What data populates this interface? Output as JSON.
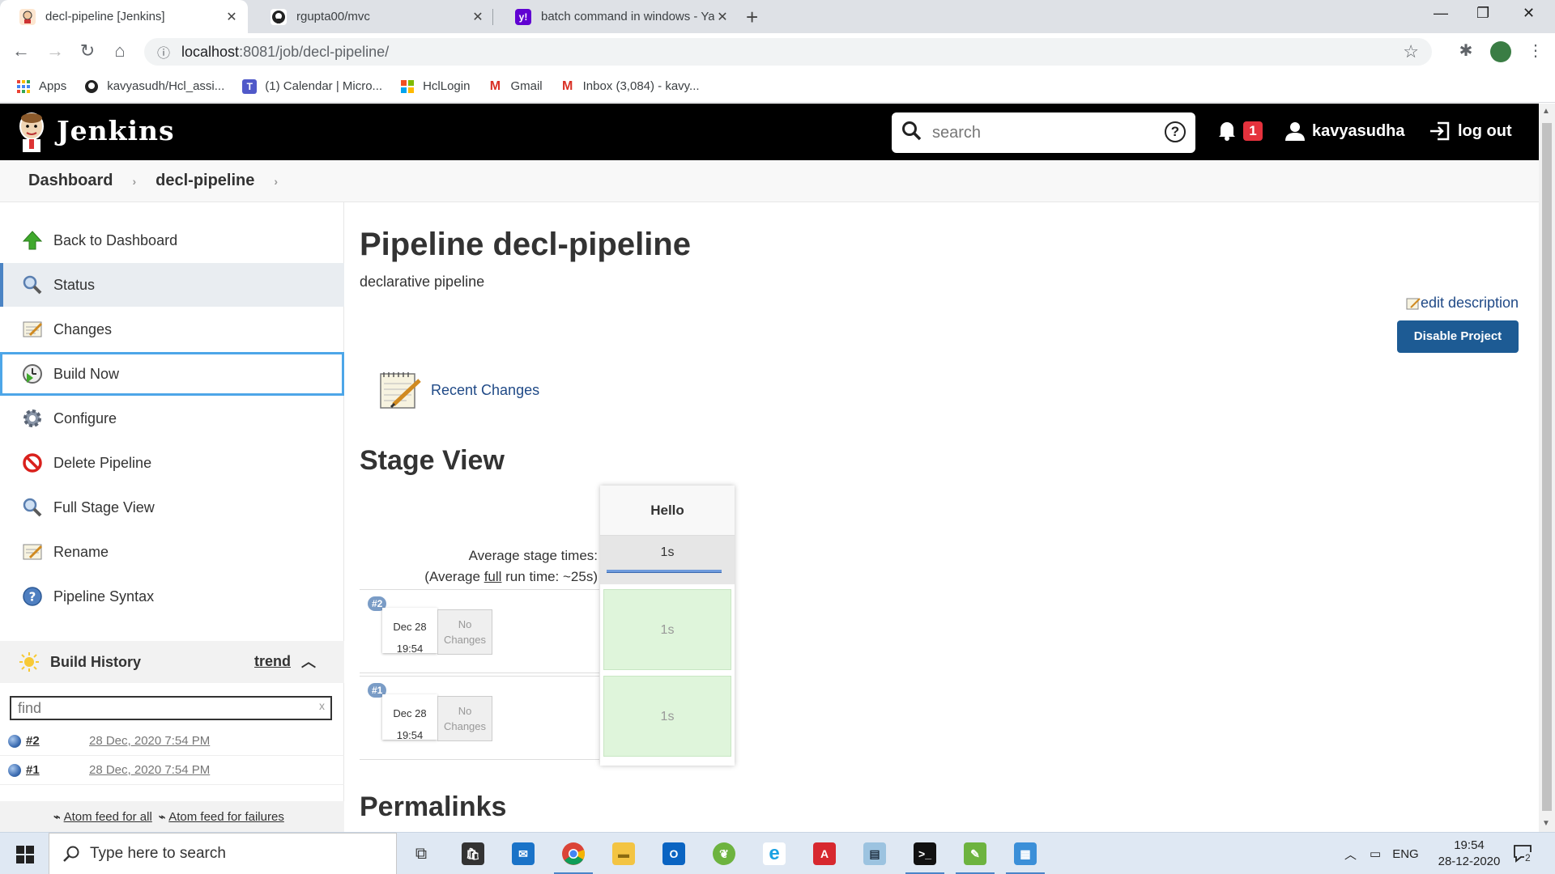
{
  "browser": {
    "tabs": [
      {
        "title": "decl-pipeline [Jenkins]",
        "active": true
      },
      {
        "title": "rgupta00/mvc",
        "active": false
      },
      {
        "title": "batch command in windows - Ya",
        "active": false
      }
    ],
    "url_host": "localhost",
    "url_path": ":8081/job/decl-pipeline/",
    "bookmarks": [
      "Apps",
      "kavyasudh/Hcl_assi...",
      "(1) Calendar | Micro...",
      "HclLogin",
      "Gmail",
      "Inbox (3,084) - kavy..."
    ]
  },
  "header": {
    "brand": "Jenkins",
    "search_placeholder": "search",
    "notification_count": "1",
    "username": "kavyasudha",
    "logout_label": "log out"
  },
  "breadcrumb": [
    "Dashboard",
    "decl-pipeline"
  ],
  "sidebar": {
    "tasks": [
      {
        "label": "Back to Dashboard",
        "icon": "arrow-up-icon"
      },
      {
        "label": "Status",
        "icon": "search-icon"
      },
      {
        "label": "Changes",
        "icon": "notepad-icon"
      },
      {
        "label": "Build Now",
        "icon": "clock-play-icon"
      },
      {
        "label": "Configure",
        "icon": "gear-icon"
      },
      {
        "label": "Delete Pipeline",
        "icon": "no-entry-icon"
      },
      {
        "label": "Full Stage View",
        "icon": "search-icon"
      },
      {
        "label": "Rename",
        "icon": "notepad-icon"
      },
      {
        "label": "Pipeline Syntax",
        "icon": "help-icon"
      }
    ],
    "build_history": {
      "title": "Build History",
      "trend_label": "trend",
      "find_placeholder": "find",
      "find_clear": "x",
      "builds": [
        {
          "number": "#2",
          "date": "28 Dec, 2020 7:54 PM"
        },
        {
          "number": "#1",
          "date": "28 Dec, 2020 7:54 PM"
        }
      ],
      "feed_all": "Atom feed for all",
      "feed_failures": "Atom feed for failures"
    }
  },
  "main": {
    "title": "Pipeline decl-pipeline",
    "description": "declarative pipeline",
    "edit_description": "edit description",
    "disable_button": "Disable Project",
    "recent_changes": "Recent Changes",
    "stage_view_title": "Stage View",
    "stage": {
      "name": "Hello",
      "avg_time": "1s",
      "avg_label": "Average stage times:",
      "avg_full_prefix": "(Average ",
      "avg_full_word": "full",
      "avg_full_suffix": " run time: ~25s)"
    },
    "runs": [
      {
        "badge": "#2",
        "month_day": "Dec 28",
        "time": "19:54",
        "changes_line1": "No",
        "changes_line2": "Changes",
        "stage_time": "1s"
      },
      {
        "badge": "#1",
        "month_day": "Dec 28",
        "time": "19:54",
        "changes_line1": "No",
        "changes_line2": "Changes",
        "stage_time": "1s"
      }
    ],
    "permalinks_title": "Permalinks"
  },
  "taskbar": {
    "search_placeholder": "Type here to search",
    "lang": "ENG",
    "time": "19:54",
    "date": "28-12-2020",
    "notif_count": "2"
  },
  "colors": {
    "jenkins_header": "#000000",
    "link": "#204a87",
    "primary_button": "#1d5b94",
    "stage_success": "#dff5db",
    "notification_badge": "#e5323d"
  }
}
